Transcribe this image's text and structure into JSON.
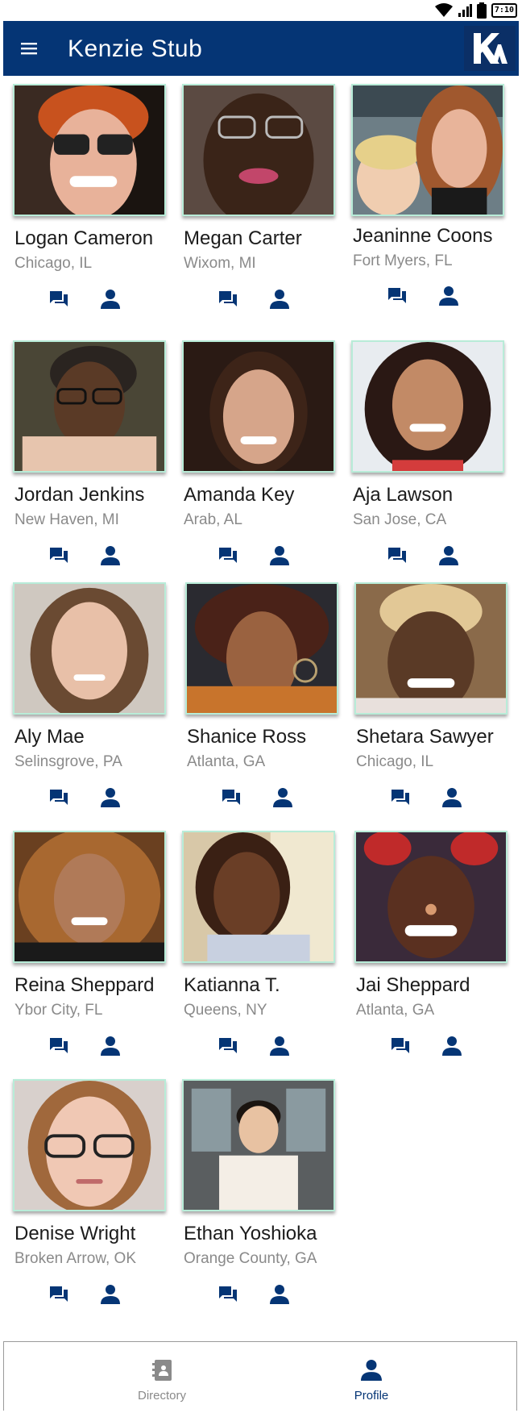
{
  "status_bar": {
    "battery": "7:10"
  },
  "app_bar": {
    "title": "Kenzie Stub",
    "logo_text": "KA"
  },
  "colors": {
    "primary": "#053575",
    "photo_border": "#b8ecd8",
    "muted": "#8a8a8a"
  },
  "people": [
    {
      "name": "Logan Cameron",
      "location": "Chicago, IL"
    },
    {
      "name": "Megan Carter",
      "location": "Wixom, MI"
    },
    {
      "name": "Jeaninne Coons",
      "location": "Fort Myers, FL"
    },
    {
      "name": "Jordan Jenkins",
      "location": "New Haven, MI"
    },
    {
      "name": "Amanda Key",
      "location": "Arab, AL"
    },
    {
      "name": "Aja Lawson",
      "location": "San Jose, CA"
    },
    {
      "name": "Aly Mae",
      "location": "Selinsgrove, PA"
    },
    {
      "name": "Shanice Ross",
      "location": "Atlanta, GA"
    },
    {
      "name": "Shetara Sawyer",
      "location": "Chicago, IL"
    },
    {
      "name": "Reina Sheppard",
      "location": "Ybor City, FL"
    },
    {
      "name": "Katianna T.",
      "location": "Queens, NY"
    },
    {
      "name": "Jai Sheppard",
      "location": "Atlanta, GA"
    },
    {
      "name": "Denise Wright",
      "location": "Broken Arrow, OK"
    },
    {
      "name": "Ethan Yoshioka",
      "location": "Orange County, GA"
    }
  ],
  "bottom_nav": {
    "directory_label": "Directory",
    "profile_label": "Profile",
    "active": "Profile"
  }
}
